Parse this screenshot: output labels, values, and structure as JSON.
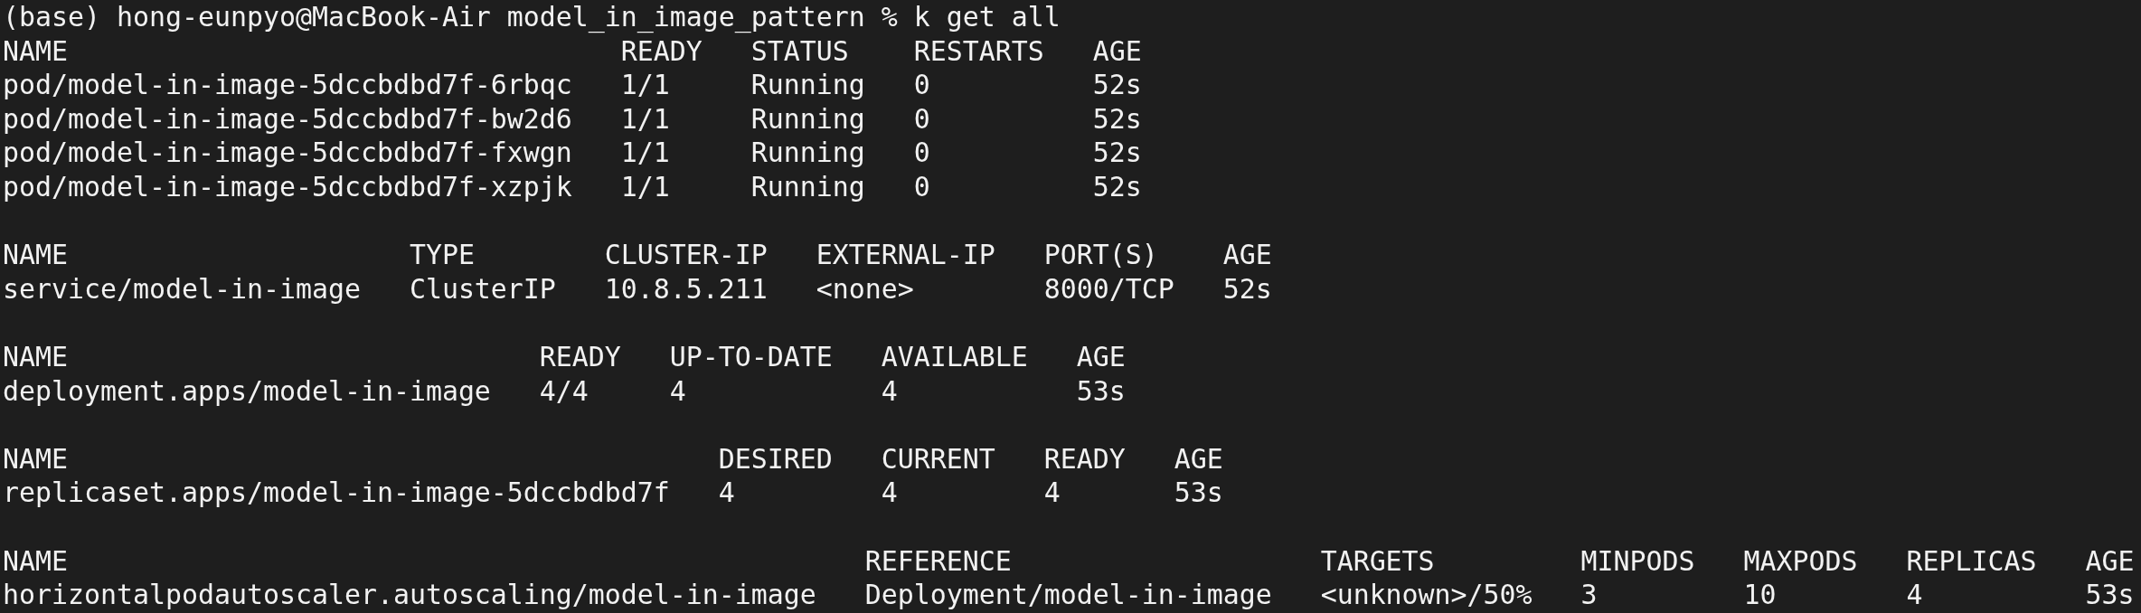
{
  "prompt": "(base) hong-eunpyo@MacBook-Air model_in_image_pattern % k get all",
  "tables": [
    {
      "columns": [
        "NAME",
        "READY",
        "STATUS",
        "RESTARTS",
        "AGE"
      ],
      "rows": [
        [
          "pod/model-in-image-5dccbdbd7f-6rbqc",
          "1/1",
          "Running",
          "0",
          "52s"
        ],
        [
          "pod/model-in-image-5dccbdbd7f-bw2d6",
          "1/1",
          "Running",
          "0",
          "52s"
        ],
        [
          "pod/model-in-image-5dccbdbd7f-fxwgn",
          "1/1",
          "Running",
          "0",
          "52s"
        ],
        [
          "pod/model-in-image-5dccbdbd7f-xzpjk",
          "1/1",
          "Running",
          "0",
          "52s"
        ]
      ]
    },
    {
      "columns": [
        "NAME",
        "TYPE",
        "CLUSTER-IP",
        "EXTERNAL-IP",
        "PORT(S)",
        "AGE"
      ],
      "rows": [
        [
          "service/model-in-image",
          "ClusterIP",
          "10.8.5.211",
          "<none>",
          "8000/TCP",
          "52s"
        ]
      ]
    },
    {
      "columns": [
        "NAME",
        "READY",
        "UP-TO-DATE",
        "AVAILABLE",
        "AGE"
      ],
      "rows": [
        [
          "deployment.apps/model-in-image",
          "4/4",
          "4",
          "4",
          "53s"
        ]
      ]
    },
    {
      "columns": [
        "NAME",
        "DESIRED",
        "CURRENT",
        "READY",
        "AGE"
      ],
      "rows": [
        [
          "replicaset.apps/model-in-image-5dccbdbd7f",
          "4",
          "4",
          "4",
          "53s"
        ]
      ]
    },
    {
      "columns": [
        "NAME",
        "REFERENCE",
        "TARGETS",
        "MINPODS",
        "MAXPODS",
        "REPLICAS",
        "AGE"
      ],
      "rows": [
        [
          "horizontalpodautoscaler.autoscaling/model-in-image",
          "Deployment/model-in-image",
          "<unknown>/50%",
          "3",
          "10",
          "4",
          "53s"
        ]
      ]
    }
  ]
}
